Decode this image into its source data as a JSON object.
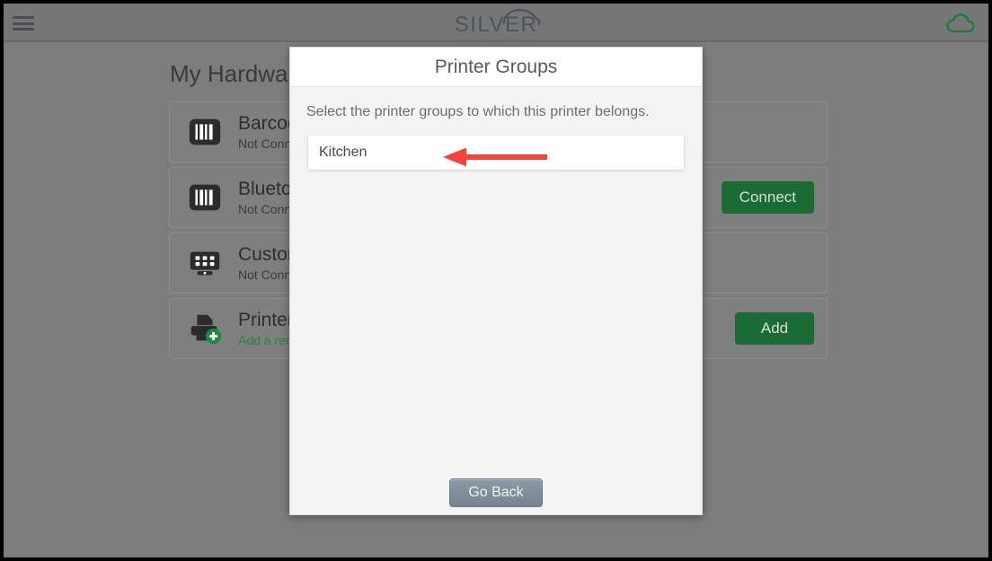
{
  "appbar": {
    "menu_icon": "hamburger-menu-icon",
    "logo_text": "SILVER",
    "logo_mark": "cloud-roof-icon",
    "cloud_status_icon": "cloud-icon",
    "cloud_status_color": "#1f7a3d"
  },
  "page": {
    "title": "My Hardware",
    "hardware": [
      {
        "icon": "barcode-scanner-icon",
        "name": "Barcode Scanner",
        "status": "Not Connected",
        "status_is_link": false,
        "action_label": ""
      },
      {
        "icon": "barcode-scanner-icon",
        "name": "Bluetooth Scanner",
        "status": "Not Connected",
        "status_is_link": false,
        "action_label": "Connect"
      },
      {
        "icon": "customer-display-icon",
        "name": "Customer Display",
        "status": "Not Connected",
        "status_is_link": false,
        "action_label": ""
      },
      {
        "icon": "add-printer-icon",
        "name": "Printer",
        "status": "Add a receipt printer",
        "status_is_link": true,
        "action_label": "Add"
      }
    ]
  },
  "modal": {
    "title": "Printer Groups",
    "instruction": "Select the printer groups to which this printer belongs.",
    "groups": [
      {
        "label": "Kitchen"
      }
    ],
    "go_back_label": "Go Back",
    "annotation": {
      "type": "arrow-left",
      "color": "#f4433a"
    }
  },
  "colors": {
    "accent_green": "#1b6b35",
    "link_green": "#1e8b3a",
    "page_background": "#7d7d7d",
    "appbar_background": "#767676",
    "modal_background": "#f4f4f4",
    "annotation_red": "#f4433a"
  }
}
